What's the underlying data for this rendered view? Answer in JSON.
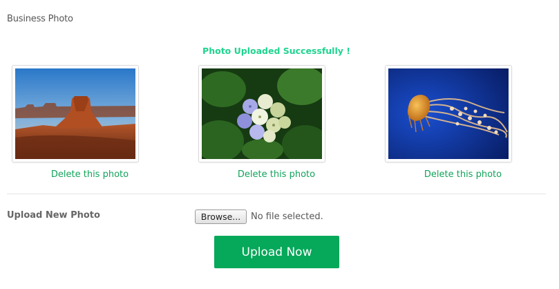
{
  "section": {
    "title": "Business Photo"
  },
  "status": {
    "message": "Photo Uploaded Successfully !",
    "color": "#1ed48f"
  },
  "photos": [
    {
      "subject": "desert-mesa",
      "delete_label": "Delete this photo"
    },
    {
      "subject": "hydrangea-flowers",
      "delete_label": "Delete this photo"
    },
    {
      "subject": "jellyfish",
      "delete_label": "Delete this photo"
    }
  ],
  "upload": {
    "label": "Upload New Photo",
    "browse_label": "Browse...",
    "file_status": "No file selected.",
    "submit_label": "Upload Now",
    "accent_color": "#06a85a"
  }
}
